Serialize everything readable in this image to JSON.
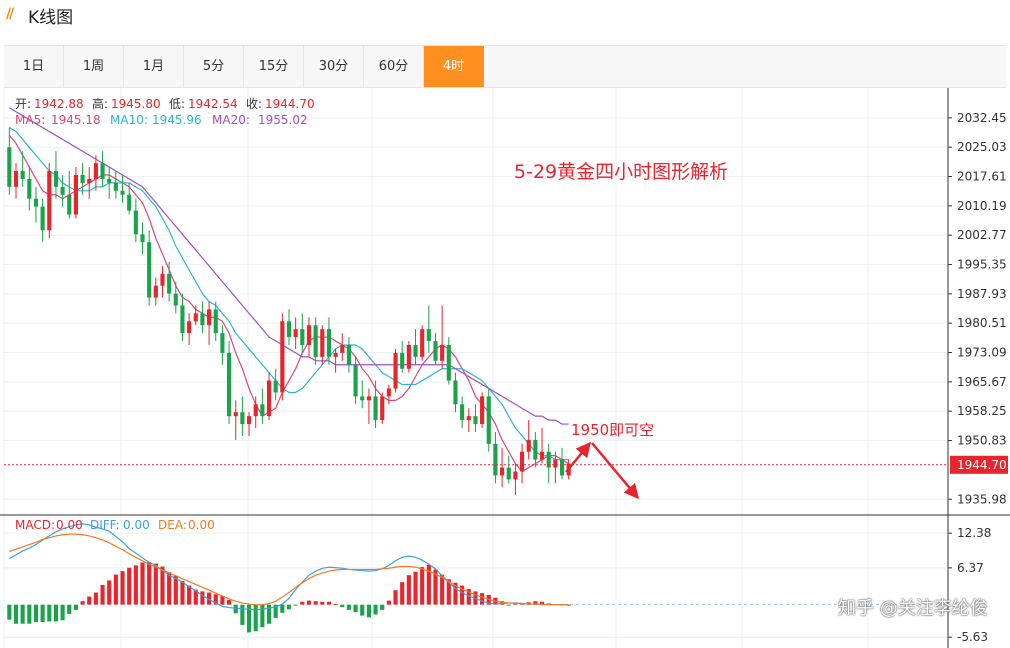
{
  "window": {
    "logo_mark": "//",
    "title": "K线图"
  },
  "tabs": [
    {
      "label": "1日",
      "active": false
    },
    {
      "label": "1周",
      "active": false
    },
    {
      "label": "1月",
      "active": false
    },
    {
      "label": "5分",
      "active": false
    },
    {
      "label": "15分",
      "active": false
    },
    {
      "label": "30分",
      "active": false
    },
    {
      "label": "60分",
      "active": false
    },
    {
      "label": "4时",
      "active": true
    }
  ],
  "colors": {
    "up": "#e8242c",
    "down": "#1aa34a",
    "ma5": "#d9487e",
    "ma10": "#2bb6cf",
    "ma20": "#a34fc4",
    "macd": "#e8242c",
    "diff": "#3ea0dc",
    "dea": "#f07b21",
    "accent": "#ff8f1f",
    "annotation": "#e8242c"
  },
  "ohlc_legend": {
    "open_label": "开:",
    "open": "1942.88",
    "high_label": "高:",
    "high": "1945.80",
    "low_label": "低:",
    "low": "1942.54",
    "close_label": "收:",
    "close": "1944.70"
  },
  "ma_legend": {
    "ma5_label": "MA5:",
    "ma5": "1945.18",
    "ma10_label": "MA10:",
    "ma10": "1945.96",
    "ma20_label": "MA20:",
    "ma20": "1955.02"
  },
  "macd_legend": {
    "macd_label": "MACD:",
    "macd": "0.00",
    "diff_label": "DIFF:",
    "diff": "0.00",
    "dea_label": "DEA:",
    "dea": "0.00"
  },
  "annotations": {
    "title": "5-29黄金四小时图形解析",
    "target_text": "1950即可空",
    "current_price": "1944.70"
  },
  "watermark": "知乎 @关注李纶俊",
  "chart_data": [
    {
      "type": "candlestick",
      "price_ticks": [
        2032.45,
        2025.03,
        2017.61,
        2010.19,
        2002.77,
        1995.35,
        1987.93,
        1980.51,
        1973.09,
        1965.67,
        1958.25,
        1950.83,
        1935.98
      ],
      "ylim": [
        1932,
        2040
      ],
      "current_price": 1944.7,
      "candles": [
        [
          2025,
          2030,
          2013,
          2015
        ],
        [
          2015,
          2021,
          2012,
          2019
        ],
        [
          2019,
          2024,
          2015,
          2017
        ],
        [
          2017,
          2020,
          2009,
          2012
        ],
        [
          2012,
          2015,
          2006,
          2010
        ],
        [
          2010,
          2012,
          2001,
          2004
        ],
        [
          2004,
          2021,
          2002,
          2019
        ],
        [
          2019,
          2024,
          2012,
          2015
        ],
        [
          2015,
          2018,
          2010,
          2013
        ],
        [
          2013,
          2019,
          2007,
          2008
        ],
        [
          2008,
          2020,
          2007,
          2018
        ],
        [
          2018,
          2021,
          2013,
          2016
        ],
        [
          2016,
          2020,
          2012,
          2017
        ],
        [
          2017,
          2023,
          2014,
          2021
        ],
        [
          2021,
          2024,
          2015,
          2017
        ],
        [
          2017,
          2020,
          2012,
          2016
        ],
        [
          2016,
          2019,
          2012,
          2014
        ],
        [
          2014,
          2018,
          2011,
          2013
        ],
        [
          2013,
          2016,
          2008,
          2009
        ],
        [
          2009,
          2012,
          2001,
          2003
        ],
        [
          2003,
          2006,
          1998,
          2001
        ],
        [
          2001,
          2004,
          1985,
          1987
        ],
        [
          1987,
          1992,
          1985,
          1990
        ],
        [
          1990,
          1995,
          1987,
          1993
        ],
        [
          1993,
          1996,
          1986,
          1988
        ],
        [
          1988,
          1991,
          1983,
          1985
        ],
        [
          1985,
          1988,
          1976,
          1978
        ],
        [
          1978,
          1983,
          1975,
          1981
        ],
        [
          1981,
          1985,
          1980,
          1983
        ],
        [
          1983,
          1986,
          1978,
          1980
        ],
        [
          1980,
          1986,
          1975,
          1984
        ],
        [
          1984,
          1986,
          1976,
          1978
        ],
        [
          1978,
          1980,
          1970,
          1973
        ],
        [
          1973,
          1976,
          1955,
          1957
        ],
        [
          1957,
          1961,
          1951,
          1958
        ],
        [
          1958,
          1962,
          1952,
          1955
        ],
        [
          1955,
          1958,
          1952,
          1957
        ],
        [
          1957,
          1962,
          1954,
          1960
        ],
        [
          1960,
          1964,
          1955,
          1957
        ],
        [
          1957,
          1968,
          1956,
          1966
        ],
        [
          1966,
          1969,
          1961,
          1963
        ],
        [
          1963,
          1983,
          1961,
          1981
        ],
        [
          1981,
          1984,
          1975,
          1977
        ],
        [
          1977,
          1982,
          1974,
          1979
        ],
        [
          1979,
          1983,
          1973,
          1975
        ],
        [
          1975,
          1982,
          1972,
          1980
        ],
        [
          1980,
          1982,
          1970,
          1972
        ],
        [
          1972,
          1980,
          1970,
          1979
        ],
        [
          1979,
          1982,
          1970,
          1972
        ],
        [
          1972,
          1974,
          1968,
          1973
        ],
        [
          1973,
          1978,
          1971,
          1975
        ],
        [
          1975,
          1977,
          1968,
          1970
        ],
        [
          1970,
          1972,
          1960,
          1962
        ],
        [
          1962,
          1966,
          1959,
          1961
        ],
        [
          1961,
          1964,
          1955,
          1962
        ],
        [
          1962,
          1966,
          1954,
          1956
        ],
        [
          1956,
          1963,
          1955,
          1962
        ],
        [
          1962,
          1965,
          1960,
          1964
        ],
        [
          1964,
          1974,
          1963,
          1973
        ],
        [
          1973,
          1976,
          1968,
          1969
        ],
        [
          1969,
          1976,
          1968,
          1975
        ],
        [
          1975,
          1979,
          1970,
          1972
        ],
        [
          1972,
          1980,
          1971,
          1979
        ],
        [
          1979,
          1985,
          1973,
          1976
        ],
        [
          1976,
          1978,
          1970,
          1971
        ],
        [
          1971,
          1985,
          1969,
          1975
        ],
        [
          1975,
          1977,
          1965,
          1966
        ],
        [
          1966,
          1968,
          1958,
          1960
        ],
        [
          1960,
          1962,
          1954,
          1956
        ],
        [
          1956,
          1959,
          1953,
          1957
        ],
        [
          1957,
          1960,
          1953,
          1955
        ],
        [
          1955,
          1963,
          1954,
          1962
        ],
        [
          1962,
          1964,
          1948,
          1950
        ],
        [
          1950,
          1953,
          1940,
          1942
        ],
        [
          1942,
          1949,
          1939,
          1944
        ],
        [
          1944,
          1947,
          1940,
          1941
        ],
        [
          1941,
          1945,
          1937,
          1943
        ],
        [
          1943,
          1950,
          1940,
          1948
        ],
        [
          1948,
          1956,
          1946,
          1951
        ],
        [
          1951,
          1953,
          1944,
          1946
        ],
        [
          1946,
          1954,
          1945,
          1948
        ],
        [
          1948,
          1950,
          1940,
          1944
        ],
        [
          1944,
          1948,
          1940,
          1946
        ],
        [
          1946,
          1949,
          1941,
          1942
        ],
        [
          1942,
          1946,
          1941,
          1945
        ]
      ],
      "ma5": [
        2028,
        2026,
        2023,
        2020,
        2017,
        2014,
        2013,
        2013,
        2012,
        2013,
        2014,
        2015,
        2016,
        2017,
        2018,
        2018,
        2017,
        2016,
        2015,
        2013,
        2011,
        2007,
        2002,
        1998,
        1994,
        1990,
        1987,
        1986,
        1984,
        1983,
        1982,
        1982,
        1981,
        1978,
        1973,
        1969,
        1964,
        1960,
        1957,
        1958,
        1959,
        1963,
        1966,
        1969,
        1973,
        1976,
        1977,
        1977,
        1977,
        1976,
        1975,
        1974,
        1972,
        1969,
        1967,
        1964,
        1962,
        1961,
        1961,
        1962,
        1964,
        1967,
        1970,
        1972,
        1974,
        1975,
        1974,
        1972,
        1969,
        1966,
        1962,
        1960,
        1958,
        1955,
        1951,
        1948,
        1945,
        1943,
        1944,
        1945,
        1946,
        1947,
        1947,
        1946,
        1945
      ],
      "ma10": [
        2030,
        2029,
        2027,
        2025,
        2023,
        2021,
        2019,
        2018,
        2016,
        2015,
        2014,
        2014,
        2014,
        2015,
        2015,
        2016,
        2016,
        2016,
        2016,
        2015,
        2014,
        2012,
        2010,
        2007,
        2004,
        2000,
        1997,
        1994,
        1991,
        1988,
        1986,
        1985,
        1983,
        1981,
        1978,
        1976,
        1974,
        1972,
        1970,
        1968,
        1966,
        1964,
        1963,
        1963,
        1964,
        1966,
        1968,
        1970,
        1972,
        1974,
        1975,
        1975,
        1975,
        1974,
        1972,
        1970,
        1968,
        1967,
        1966,
        1965,
        1965,
        1965,
        1966,
        1967,
        1968,
        1969,
        1969,
        1969,
        1969,
        1968,
        1967,
        1966,
        1964,
        1962,
        1960,
        1957,
        1954,
        1952,
        1950,
        1948,
        1947,
        1947,
        1946,
        1946,
        1946
      ],
      "ma20": [
        2035,
        2034,
        2033,
        2032,
        2031,
        2030,
        2029,
        2028,
        2027,
        2026,
        2025,
        2024,
        2023,
        2022,
        2021,
        2020,
        2019,
        2018,
        2017,
        2016,
        2015,
        2013,
        2011,
        2009,
        2007,
        2005,
        2003,
        2001,
        1999,
        1997,
        1995,
        1993,
        1991,
        1989,
        1987,
        1985,
        1983,
        1981,
        1979,
        1977,
        1976,
        1975,
        1974,
        1973,
        1972,
        1972,
        1971,
        1971,
        1971,
        1970,
        1970,
        1970,
        1970,
        1970,
        1970,
        1970,
        1970,
        1970,
        1970,
        1970,
        1970,
        1970,
        1970,
        1970,
        1970,
        1970,
        1970,
        1969,
        1968,
        1967,
        1966,
        1965,
        1964,
        1963,
        1962,
        1961,
        1960,
        1959,
        1958,
        1957,
        1957,
        1956,
        1956,
        1955,
        1955
      ]
    },
    {
      "type": "macd",
      "ticks": [
        12.38,
        6.37,
        -5.63
      ],
      "ylim": [
        -7.5,
        15
      ],
      "histogram": [
        -2.6,
        -3.3,
        -3.3,
        -3.3,
        -3,
        -3,
        -2.9,
        -2.9,
        -2.7,
        -1.6,
        -0.9,
        0.6,
        1.4,
        2.1,
        3.4,
        4.2,
        5.2,
        5.8,
        6.4,
        6.8,
        7.3,
        7.4,
        7.1,
        6.6,
        5.6,
        5,
        4.1,
        3.3,
        2.6,
        2.3,
        2.1,
        1.8,
        1.5,
        0.8,
        -1.5,
        -3.5,
        -4.8,
        -4.6,
        -3.9,
        -3.3,
        -2.3,
        -1.4,
        -0.8,
        -0.1,
        0.5,
        0.7,
        0.6,
        0.5,
        0.5,
        0.1,
        -0.4,
        -0.9,
        -1.3,
        -1.9,
        -2.2,
        -1.7,
        -0.9,
        0.7,
        2.5,
        3.9,
        5.1,
        5.7,
        6.5,
        6.9,
        6.1,
        5.2,
        4.4,
        3.8,
        3.3,
        2.7,
        2.3,
        2,
        1.7,
        1.2,
        0.6,
        -0.1,
        0.2,
        0.3,
        0.4,
        0.6,
        0.5,
        0.2,
        0.1,
        0.1,
        0.0
      ],
      "diff": [
        8,
        8.6,
        9.3,
        9.8,
        10.4,
        11.2,
        11.9,
        12.6,
        13.1,
        13.5,
        13.8,
        14.0,
        13.8,
        13.4,
        13.1,
        12.7,
        11.8,
        10.9,
        9.7,
        8.9,
        8.1,
        7.3,
        6.8,
        5.9,
        5.1,
        4.5,
        3.9,
        3.1,
        2.4,
        1.6,
        0.9,
        0.3,
        -0.3,
        -0.5,
        -0.6,
        -0.7,
        -0.8,
        -0.9,
        -0.8,
        -0.6,
        -0.4,
        0.1,
        1.1,
        2.6,
        3.9,
        5.1,
        5.8,
        6.3,
        6.5,
        6.4,
        6.3,
        6.1,
        6,
        5.9,
        5.8,
        5.9,
        6.2,
        6.8,
        7.6,
        8.2,
        8.4,
        8.2,
        7.7,
        7,
        6.2,
        5,
        3.9,
        2.8,
        2.1,
        1.5,
        1.1,
        0.6,
        0.3,
        0.1,
        0.2,
        0.3,
        0.3,
        0.2,
        0.1,
        0.1,
        0.0,
        0.0,
        0.0,
        0.0,
        0.0
      ],
      "dea": [
        9.2,
        9.6,
        10,
        10.4,
        10.8,
        11.3,
        11.6,
        11.9,
        12.1,
        12.2,
        12.2,
        12.1,
        11.9,
        11.6,
        11.2,
        10.7,
        10.1,
        9.5,
        8.8,
        8.2,
        7.6,
        7,
        6.5,
        6,
        5.5,
        5,
        4.5,
        4,
        3.5,
        3,
        2.5,
        2.0,
        1.5,
        1.0,
        0.6,
        0.3,
        0.1,
        0.0,
        0.0,
        0.2,
        0.6,
        1.3,
        2.1,
        3.0,
        3.8,
        4.5,
        5.1,
        5.5,
        5.8,
        6.0,
        6.1,
        6.1,
        6.1,
        6.1,
        6.1,
        6.1,
        6.2,
        6.3,
        6.5,
        6.6,
        6.6,
        6.5,
        6.2,
        5.8,
        5.3,
        4.7,
        4.0,
        3.3,
        2.7,
        2.2,
        1.7,
        1.3,
        0.9,
        0.6,
        0.4,
        0.3,
        0.2,
        0.2,
        0.1,
        0.1,
        0.1,
        0.0,
        0.0,
        0.0,
        0.0
      ]
    }
  ]
}
